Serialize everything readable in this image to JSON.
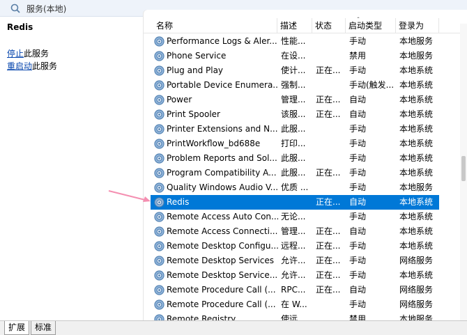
{
  "window": {
    "title": "服务(本地)"
  },
  "left_pane": {
    "service_name": "Redis",
    "actions": [
      {
        "link": "停止",
        "text": "此服务"
      },
      {
        "link": "重启动",
        "text": "此服务"
      }
    ]
  },
  "columns": [
    "名称",
    "描述",
    "状态",
    "启动类型",
    "登录为"
  ],
  "services": [
    {
      "name": "Performance Logs & Aler...",
      "desc": "性能...",
      "status": "",
      "startup": "手动",
      "logon": "本地服务"
    },
    {
      "name": "Phone Service",
      "desc": "在设...",
      "status": "",
      "startup": "禁用",
      "logon": "本地服务"
    },
    {
      "name": "Plug and Play",
      "desc": "使计...",
      "status": "正在...",
      "startup": "手动",
      "logon": "本地系统"
    },
    {
      "name": "Portable Device Enumera...",
      "desc": "强制...",
      "status": "",
      "startup": "手动(触发...",
      "logon": "本地系统"
    },
    {
      "name": "Power",
      "desc": "管理...",
      "status": "正在...",
      "startup": "自动",
      "logon": "本地系统"
    },
    {
      "name": "Print Spooler",
      "desc": "该服...",
      "status": "正在...",
      "startup": "自动",
      "logon": "本地系统"
    },
    {
      "name": "Printer Extensions and N...",
      "desc": "此服...",
      "status": "",
      "startup": "手动",
      "logon": "本地系统"
    },
    {
      "name": "PrintWorkflow_bd688e",
      "desc": "打印...",
      "status": "",
      "startup": "手动",
      "logon": "本地系统"
    },
    {
      "name": "Problem Reports and Sol...",
      "desc": "此服...",
      "status": "",
      "startup": "手动",
      "logon": "本地系统"
    },
    {
      "name": "Program Compatibility A...",
      "desc": "此服...",
      "status": "正在...",
      "startup": "手动",
      "logon": "本地系统"
    },
    {
      "name": "Quality Windows Audio V...",
      "desc": "优质 ...",
      "status": "",
      "startup": "手动",
      "logon": "本地服务"
    },
    {
      "name": "Redis",
      "desc": "",
      "status": "正在...",
      "startup": "自动",
      "logon": "本地系统",
      "selected": true
    },
    {
      "name": "Remote Access Auto Con...",
      "desc": "无论...",
      "status": "",
      "startup": "手动",
      "logon": "本地系统"
    },
    {
      "name": "Remote Access Connecti...",
      "desc": "管理...",
      "status": "正在...",
      "startup": "自动",
      "logon": "本地系统"
    },
    {
      "name": "Remote Desktop Configu...",
      "desc": "远程...",
      "status": "正在...",
      "startup": "手动",
      "logon": "本地系统"
    },
    {
      "name": "Remote Desktop Services",
      "desc": "允许...",
      "status": "正在...",
      "startup": "手动",
      "logon": "网络服务"
    },
    {
      "name": "Remote Desktop Service...",
      "desc": "允许...",
      "status": "正在...",
      "startup": "手动",
      "logon": "本地系统"
    },
    {
      "name": "Remote Procedure Call (...",
      "desc": "RPC...",
      "status": "正在...",
      "startup": "自动",
      "logon": "网络服务"
    },
    {
      "name": "Remote Procedure Call (...",
      "desc": "在 W...",
      "status": "",
      "startup": "手动",
      "logon": "网络服务"
    },
    {
      "name": "Remote Registry",
      "desc": "使远...",
      "status": "",
      "startup": "禁用",
      "logon": "本地服务"
    }
  ],
  "tabs": [
    "扩展",
    "标准"
  ],
  "colors": {
    "selection": "#0078d7",
    "link": "#0645ad",
    "arrow": "#f48fb1"
  },
  "icons": {
    "title": "services-icon",
    "row": "gear-icon",
    "annotation": "pink-arrow"
  }
}
